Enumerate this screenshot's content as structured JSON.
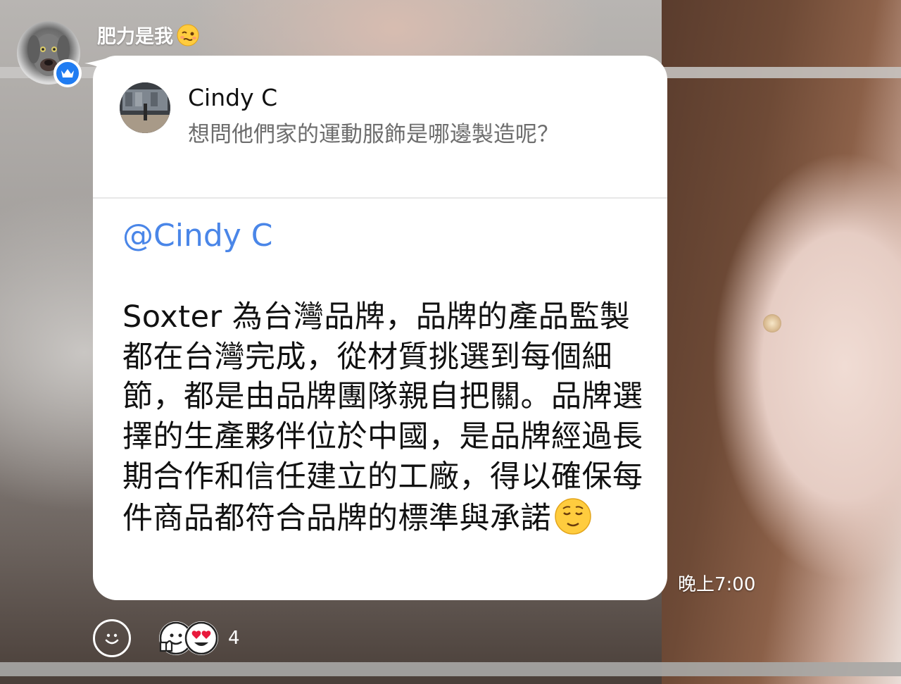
{
  "sender": {
    "name": "肥力是我",
    "avatar_icon": "dog-avatar-icon",
    "badge_icon": "crown-badge-icon"
  },
  "quoted": {
    "name": "Cindy C",
    "text": "想問他們家的運動服飾是哪邊製造呢？"
  },
  "reply": {
    "mention": "@Cindy C",
    "text": "Soxter 為台灣品牌，品牌的產品監製都在台灣完成，從材質挑選到每個細節，都是由品牌團隊親自把關。品牌選擇的生產夥伴位於中國，是品牌經過長期合作和信任建立的工廠，得以確保每件商品都符合品牌的標準與承諾",
    "emoji": "relieved-face-emoji",
    "time": "晚上7:00"
  },
  "reactions": {
    "icons": [
      "thumbs-up-face-icon",
      "heart-eyes-face-icon"
    ],
    "count": "4",
    "add_icon": "smiley-add-reaction-icon"
  },
  "colors": {
    "mention": "#4a86e8",
    "badge": "#1f7cf2",
    "bubble": "#ffffff"
  }
}
